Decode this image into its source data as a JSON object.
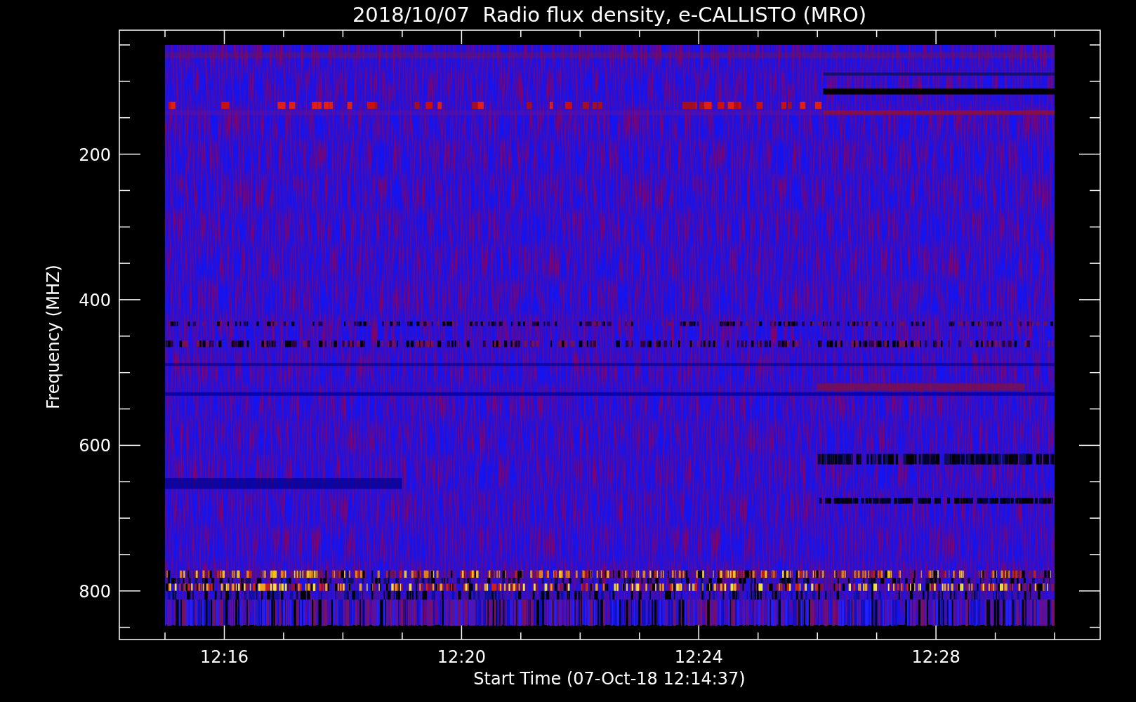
{
  "title": "2018/10/07  Radio flux density, e-CALLISTO (MRO)",
  "y_axis": {
    "title": "Frequency (MHZ)",
    "ticks": [
      "200",
      "400",
      "600",
      "800"
    ]
  },
  "x_axis": {
    "title": "Start Time (07-Oct-18 12:14:37)",
    "ticks": [
      "12:16",
      "12:20",
      "12:24",
      "12:28"
    ]
  }
}
